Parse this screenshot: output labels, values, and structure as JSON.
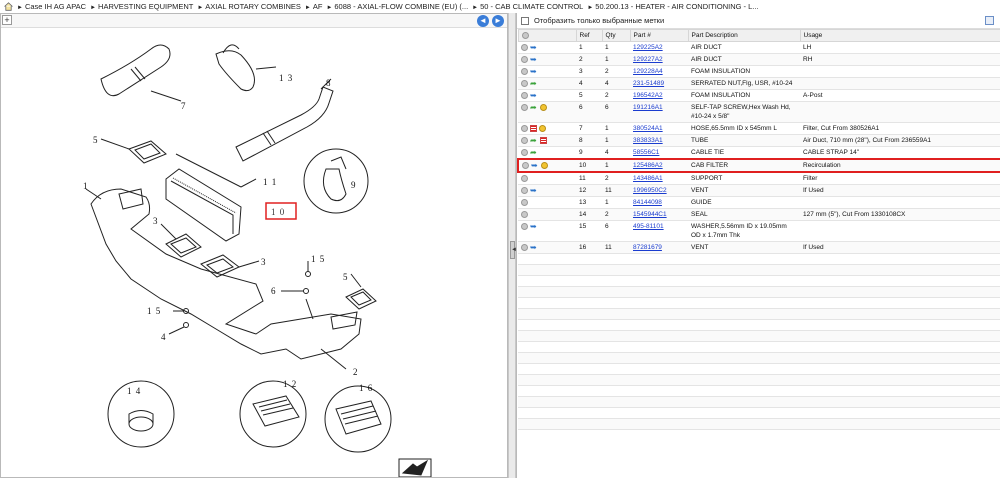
{
  "breadcrumb": {
    "items": [
      "Case IH AG APAC",
      "HARVESTING EQUIPMENT",
      "AXIAL ROTARY COMBINES",
      "AF",
      "6088 - AXIAL-FLOW COMBINE (EU) (...",
      "50 - CAB CLIMATE CONTROL",
      "50.200.13 - HEATER - AIR CONDITIONING - L..."
    ]
  },
  "toolbar": {
    "expand": "+",
    "nav_back": "◄",
    "nav_forward": "►"
  },
  "filter": {
    "label": "Отобразить только выбранные метки"
  },
  "table": {
    "headers": [
      "",
      "Ref",
      "Qty",
      "Part #",
      "Part Description",
      "Usage"
    ],
    "rows": [
      {
        "icons": [
          "circle",
          "blue"
        ],
        "ref": "1",
        "qty": "1",
        "part": "129225A2",
        "desc": "AIR DUCT",
        "usage": "LH"
      },
      {
        "icons": [
          "circle",
          "blue"
        ],
        "ref": "2",
        "qty": "1",
        "part": "129227A2",
        "desc": "AIR DUCT",
        "usage": "RH"
      },
      {
        "icons": [
          "circle",
          "blue"
        ],
        "ref": "3",
        "qty": "2",
        "part": "129228A4",
        "desc": "FOAM INSULATION",
        "usage": ""
      },
      {
        "icons": [
          "circle",
          "green"
        ],
        "ref": "4",
        "qty": "4",
        "part": "231-51489",
        "desc": "SERRATED NUT,Flg, USR, #10-24",
        "usage": ""
      },
      {
        "icons": [
          "circle",
          "blue"
        ],
        "ref": "5",
        "qty": "2",
        "part": "196542A2",
        "desc": "FOAM INSULATION",
        "usage": "A-Post"
      },
      {
        "icons": [
          "circle",
          "green",
          "coin"
        ],
        "ref": "6",
        "qty": "6",
        "part": "191216A1",
        "desc": "SELF-TAP SCREW,Hex Wash Hd, #10-24 x 5/8\"",
        "usage": ""
      },
      {
        "icons": [
          "circle",
          "list",
          "coin"
        ],
        "ref": "7",
        "qty": "1",
        "part": "380524A1",
        "desc": "HOSE,65.5mm ID x 545mm L",
        "usage": "Filter, Cut From 380526A1"
      },
      {
        "icons": [
          "circle",
          "green",
          "list"
        ],
        "ref": "8",
        "qty": "1",
        "part": "383833A1",
        "desc": "TUBE",
        "usage": "Air Duct, 710 mm (28\"), Cut From 236559A1"
      },
      {
        "icons": [
          "circle",
          "green"
        ],
        "ref": "9",
        "qty": "4",
        "part": "58556C1",
        "desc": "CABLE TIE",
        "usage": "CABLE STRAP 14\""
      },
      {
        "icons": [
          "circle",
          "blue",
          "coin"
        ],
        "ref": "10",
        "qty": "1",
        "part": "125486A2",
        "desc": "CAB FILTER",
        "usage": "Recirculation",
        "selected": true
      },
      {
        "icons": [
          "circle"
        ],
        "ref": "11",
        "qty": "2",
        "part": "143486A1",
        "desc": "SUPPORT",
        "usage": "Filter"
      },
      {
        "icons": [
          "circle",
          "blue"
        ],
        "ref": "12",
        "qty": "11",
        "part": "1996950C2",
        "desc": "VENT",
        "usage": "If Used"
      },
      {
        "icons": [
          "circle"
        ],
        "ref": "13",
        "qty": "1",
        "part": "84144098",
        "desc": "GUIDE",
        "usage": ""
      },
      {
        "icons": [
          "circle"
        ],
        "ref": "14",
        "qty": "2",
        "part": "1545944C1",
        "desc": "SEAL",
        "usage": "127 mm (5\"), Cut From 1330108CX"
      },
      {
        "icons": [
          "circle",
          "blue"
        ],
        "ref": "15",
        "qty": "6",
        "part": "495-81101",
        "desc": "WASHER,5.56mm ID x 19.05mm OD x 1.7mm Thk",
        "usage": ""
      },
      {
        "icons": [
          "circle",
          "blue"
        ],
        "ref": "16",
        "qty": "11",
        "part": "87281679",
        "desc": "VENT",
        "usage": "If Used"
      }
    ]
  },
  "diagram": {
    "callouts": [
      "1 3",
      "7",
      "8",
      "5",
      "1 1",
      "9",
      "1",
      "1 0",
      "3",
      "3",
      "1 5",
      "6",
      "5",
      "1 5",
      "4",
      "2",
      "1 4",
      "1 2",
      "1 6"
    ],
    "highlighted_callout": "1 0",
    "highlight_color": "#e02020"
  }
}
